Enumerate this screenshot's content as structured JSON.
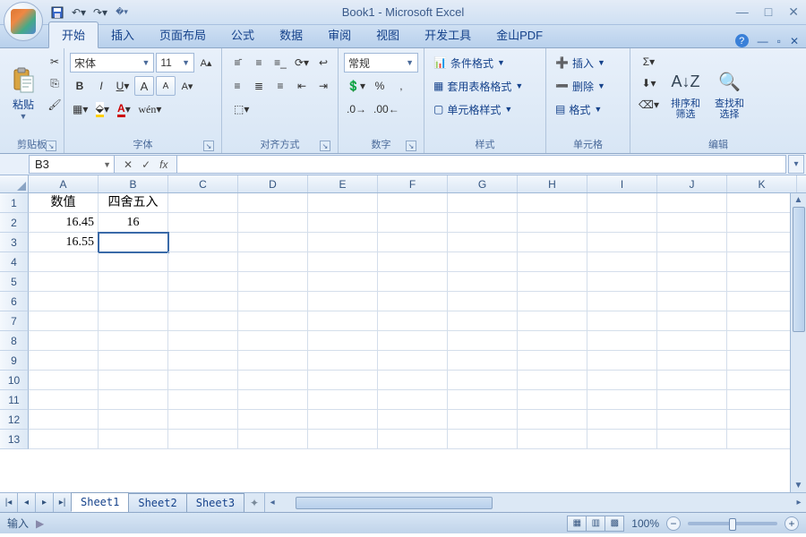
{
  "app": {
    "title": "Book1 - Microsoft Excel"
  },
  "tabs": [
    "开始",
    "插入",
    "页面布局",
    "公式",
    "数据",
    "审阅",
    "视图",
    "开发工具",
    "金山PDF"
  ],
  "active_tab": 0,
  "ribbon": {
    "clipboard": {
      "label": "剪贴板",
      "paste": "粘贴"
    },
    "font": {
      "label": "字体",
      "family": "宋体",
      "size": "11"
    },
    "align": {
      "label": "对齐方式"
    },
    "number": {
      "label": "数字",
      "format": "常规"
    },
    "styles": {
      "label": "样式",
      "cond": "条件格式",
      "tbl": "套用表格格式",
      "cell": "单元格样式"
    },
    "cells": {
      "label": "单元格",
      "insert": "插入",
      "delete": "删除",
      "format": "格式"
    },
    "edit": {
      "label": "编辑",
      "sort": "排序和\n筛选",
      "find": "查找和\n选择"
    }
  },
  "namebox": "B3",
  "columns": [
    "A",
    "B",
    "C",
    "D",
    "E",
    "F",
    "G",
    "H",
    "I",
    "J",
    "K"
  ],
  "rows": 13,
  "cells": {
    "A1": "数值",
    "B1": "四舍五入",
    "A2": "16.45",
    "B2": "16",
    "A3": "16.55"
  },
  "active_cell": "B3",
  "sheets": [
    "Sheet1",
    "Sheet2",
    "Sheet3"
  ],
  "active_sheet": 0,
  "status": {
    "mode": "输入",
    "zoom": "100%"
  }
}
